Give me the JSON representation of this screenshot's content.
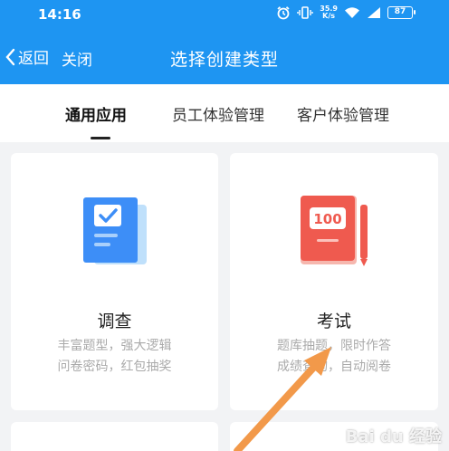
{
  "status_bar": {
    "time": "14:16",
    "net_speed_value": "35.9",
    "net_speed_unit": "K/s",
    "battery": "87"
  },
  "navbar": {
    "back_label": "返回",
    "close_label": "关闭",
    "title": "选择创建类型"
  },
  "tabs": [
    {
      "label": "通用应用",
      "active": true
    },
    {
      "label": "员工体验管理",
      "active": false
    },
    {
      "label": "客户体验管理",
      "active": false
    }
  ],
  "cards": [
    {
      "title": "调查",
      "desc_line1": "丰富题型，强大逻辑",
      "desc_line2": "问卷密码，红包抽奖",
      "icon": "survey-icon",
      "icon_color": "#3d8ef7"
    },
    {
      "title": "考试",
      "desc_line1": "题库抽题，限时作答",
      "desc_line2": "成绩查询，自动阅卷",
      "icon": "exam-icon",
      "icon_color": "#ef5a4f",
      "icon_text": "100"
    }
  ],
  "watermark": "Bai du 经验",
  "colors": {
    "header": "#1e95f2",
    "background": "#f2f3f5",
    "arrow": "#f2994a"
  }
}
